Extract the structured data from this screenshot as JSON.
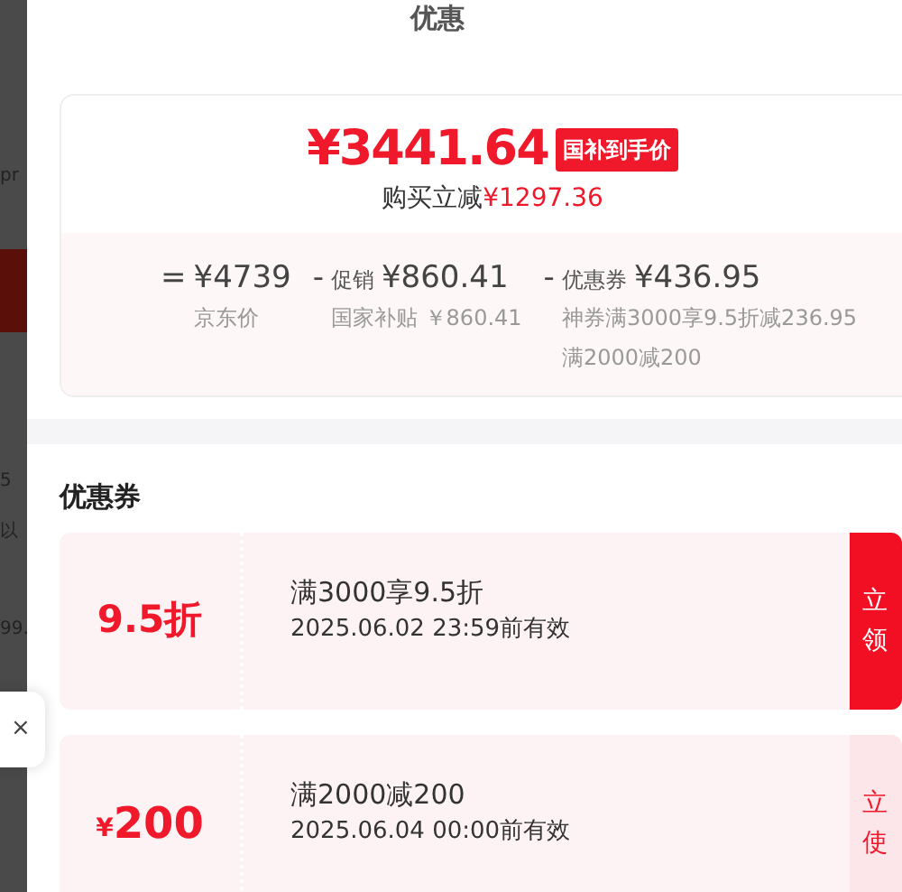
{
  "backdrop": {
    "fragments": [
      "pr",
      "5",
      "以",
      "99."
    ]
  },
  "sheet": {
    "title": "优惠",
    "summary": {
      "price": "¥3441.64",
      "badge": "国补到手价",
      "saving_label": "购买立减",
      "saving": "¥1297.36",
      "breakdown": [
        {
          "op": "=",
          "amount": "¥4739",
          "notes": [
            "京东价"
          ]
        },
        {
          "op": "-",
          "label": "促销",
          "amount": "¥860.41",
          "notes": [
            "国家补贴 ￥860.41"
          ]
        },
        {
          "op": "-",
          "label": "优惠券",
          "amount": "¥436.95",
          "notes": [
            "神券满3000享9.5折减236.95",
            "满2000减200"
          ]
        }
      ]
    },
    "coupons_heading": "优惠券",
    "coupons": [
      {
        "kind": "discount",
        "value": "9.5折",
        "condition": "满3000享9.5折",
        "validity": "2025.06.02 23:59前有效",
        "action": {
          "kind": "claim",
          "lines": [
            "立",
            "领"
          ]
        }
      },
      {
        "kind": "cash",
        "currency": "¥",
        "value": "200",
        "condition": "满2000减200",
        "validity": "2025.06.04 00:00前有效",
        "action": {
          "kind": "use",
          "lines": [
            "立",
            "使"
          ]
        }
      }
    ]
  },
  "popup": {
    "close": "×"
  }
}
